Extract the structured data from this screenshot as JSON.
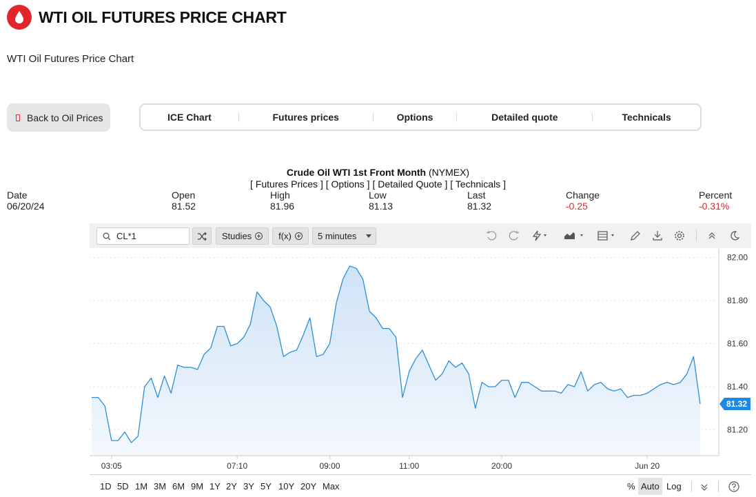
{
  "header": {
    "title": "WTI OIL FUTURES PRICE CHART",
    "subtitle": "WTI Oil Futures Price Chart",
    "brand_color": "#e0252b"
  },
  "nav": {
    "back_label": "Back to Oil Prices",
    "tabs": [
      "ICE Chart",
      "Futures prices",
      "Options",
      "Detailed quote",
      "Technicals"
    ]
  },
  "quote": {
    "name": "Crude Oil WTI 1st Front Month",
    "exchange": "(NYMEX)",
    "links": [
      "[ Futures Prices ]",
      "[ Options ]",
      "[ Detailed Quote ]",
      "[ Technicals ]"
    ],
    "stats": [
      {
        "label": "Date",
        "value": "06/20/24",
        "negative": false
      },
      {
        "label": "Open",
        "value": "81.52",
        "negative": false
      },
      {
        "label": "High",
        "value": "81.96",
        "negative": false
      },
      {
        "label": "Low",
        "value": "81.13",
        "negative": false
      },
      {
        "label": "Last",
        "value": "81.32",
        "negative": false
      },
      {
        "label": "Change",
        "value": "-0.25",
        "negative": true
      },
      {
        "label": "Percent",
        "value": "-0.31%",
        "negative": true
      }
    ]
  },
  "toolbar": {
    "symbol": "CL*1",
    "studies_label": "Studies",
    "fx_label": "f(x)",
    "interval_label": "5 minutes",
    "icons": [
      "undo-icon",
      "redo-icon",
      "drawing-tools-icon",
      "chart-type-icon",
      "layout-icon",
      "pencil-icon",
      "download-icon",
      "settings-icon",
      "collapse-icon",
      "dark-mode-icon"
    ]
  },
  "ranges": [
    "1D",
    "5D",
    "1M",
    "3M",
    "6M",
    "9M",
    "1Y",
    "2Y",
    "3Y",
    "5Y",
    "10Y",
    "20Y",
    "Max"
  ],
  "scale_options": {
    "percent": "%",
    "auto": "Auto",
    "log": "Log"
  },
  "chart_data": {
    "type": "area",
    "symbol": "CL*1",
    "interval": "5 minutes",
    "ylim": [
      81.08,
      82.04
    ],
    "yticks": [
      82.0,
      81.8,
      81.6,
      81.4,
      81.2
    ],
    "ytick_labels": [
      "82.00",
      "81.80",
      "81.60",
      "81.40",
      "81.20"
    ],
    "xtick_labels": [
      {
        "label": "03:05",
        "index": 3
      },
      {
        "label": "07:10",
        "index": 22
      },
      {
        "label": "09:00",
        "index": 36
      },
      {
        "label": "11:00",
        "index": 48
      },
      {
        "label": "20:00",
        "index": 62
      },
      {
        "label": "Jun 20",
        "index": 84
      }
    ],
    "grid": true,
    "last_price": "81.32",
    "colors": {
      "line": "#2a8fd8",
      "fill_top": "#cfe3f7",
      "fill_bottom": "#f3f8fd",
      "last_badge": "#1e88e5"
    },
    "values": [
      81.35,
      81.35,
      81.31,
      81.15,
      81.15,
      81.19,
      81.14,
      81.17,
      81.4,
      81.44,
      81.35,
      81.45,
      81.37,
      81.5,
      81.49,
      81.49,
      81.48,
      81.55,
      81.58,
      81.68,
      81.68,
      81.59,
      81.6,
      81.63,
      81.69,
      81.84,
      81.8,
      81.77,
      81.68,
      81.54,
      81.56,
      81.57,
      81.64,
      81.72,
      81.54,
      81.55,
      81.6,
      81.79,
      81.9,
      81.96,
      81.95,
      81.9,
      81.75,
      81.72,
      81.67,
      81.67,
      81.63,
      81.35,
      81.47,
      81.53,
      81.57,
      81.5,
      81.43,
      81.46,
      81.52,
      81.49,
      81.51,
      81.46,
      81.3,
      81.42,
      81.4,
      81.4,
      81.43,
      81.43,
      81.35,
      81.42,
      81.42,
      81.4,
      81.38,
      81.38,
      81.38,
      81.37,
      81.41,
      81.4,
      81.47,
      81.38,
      81.41,
      81.42,
      81.39,
      81.38,
      81.39,
      81.35,
      81.36,
      81.36,
      81.37,
      81.39,
      81.41,
      81.42,
      81.41,
      81.42,
      81.46,
      81.54,
      81.32
    ]
  }
}
